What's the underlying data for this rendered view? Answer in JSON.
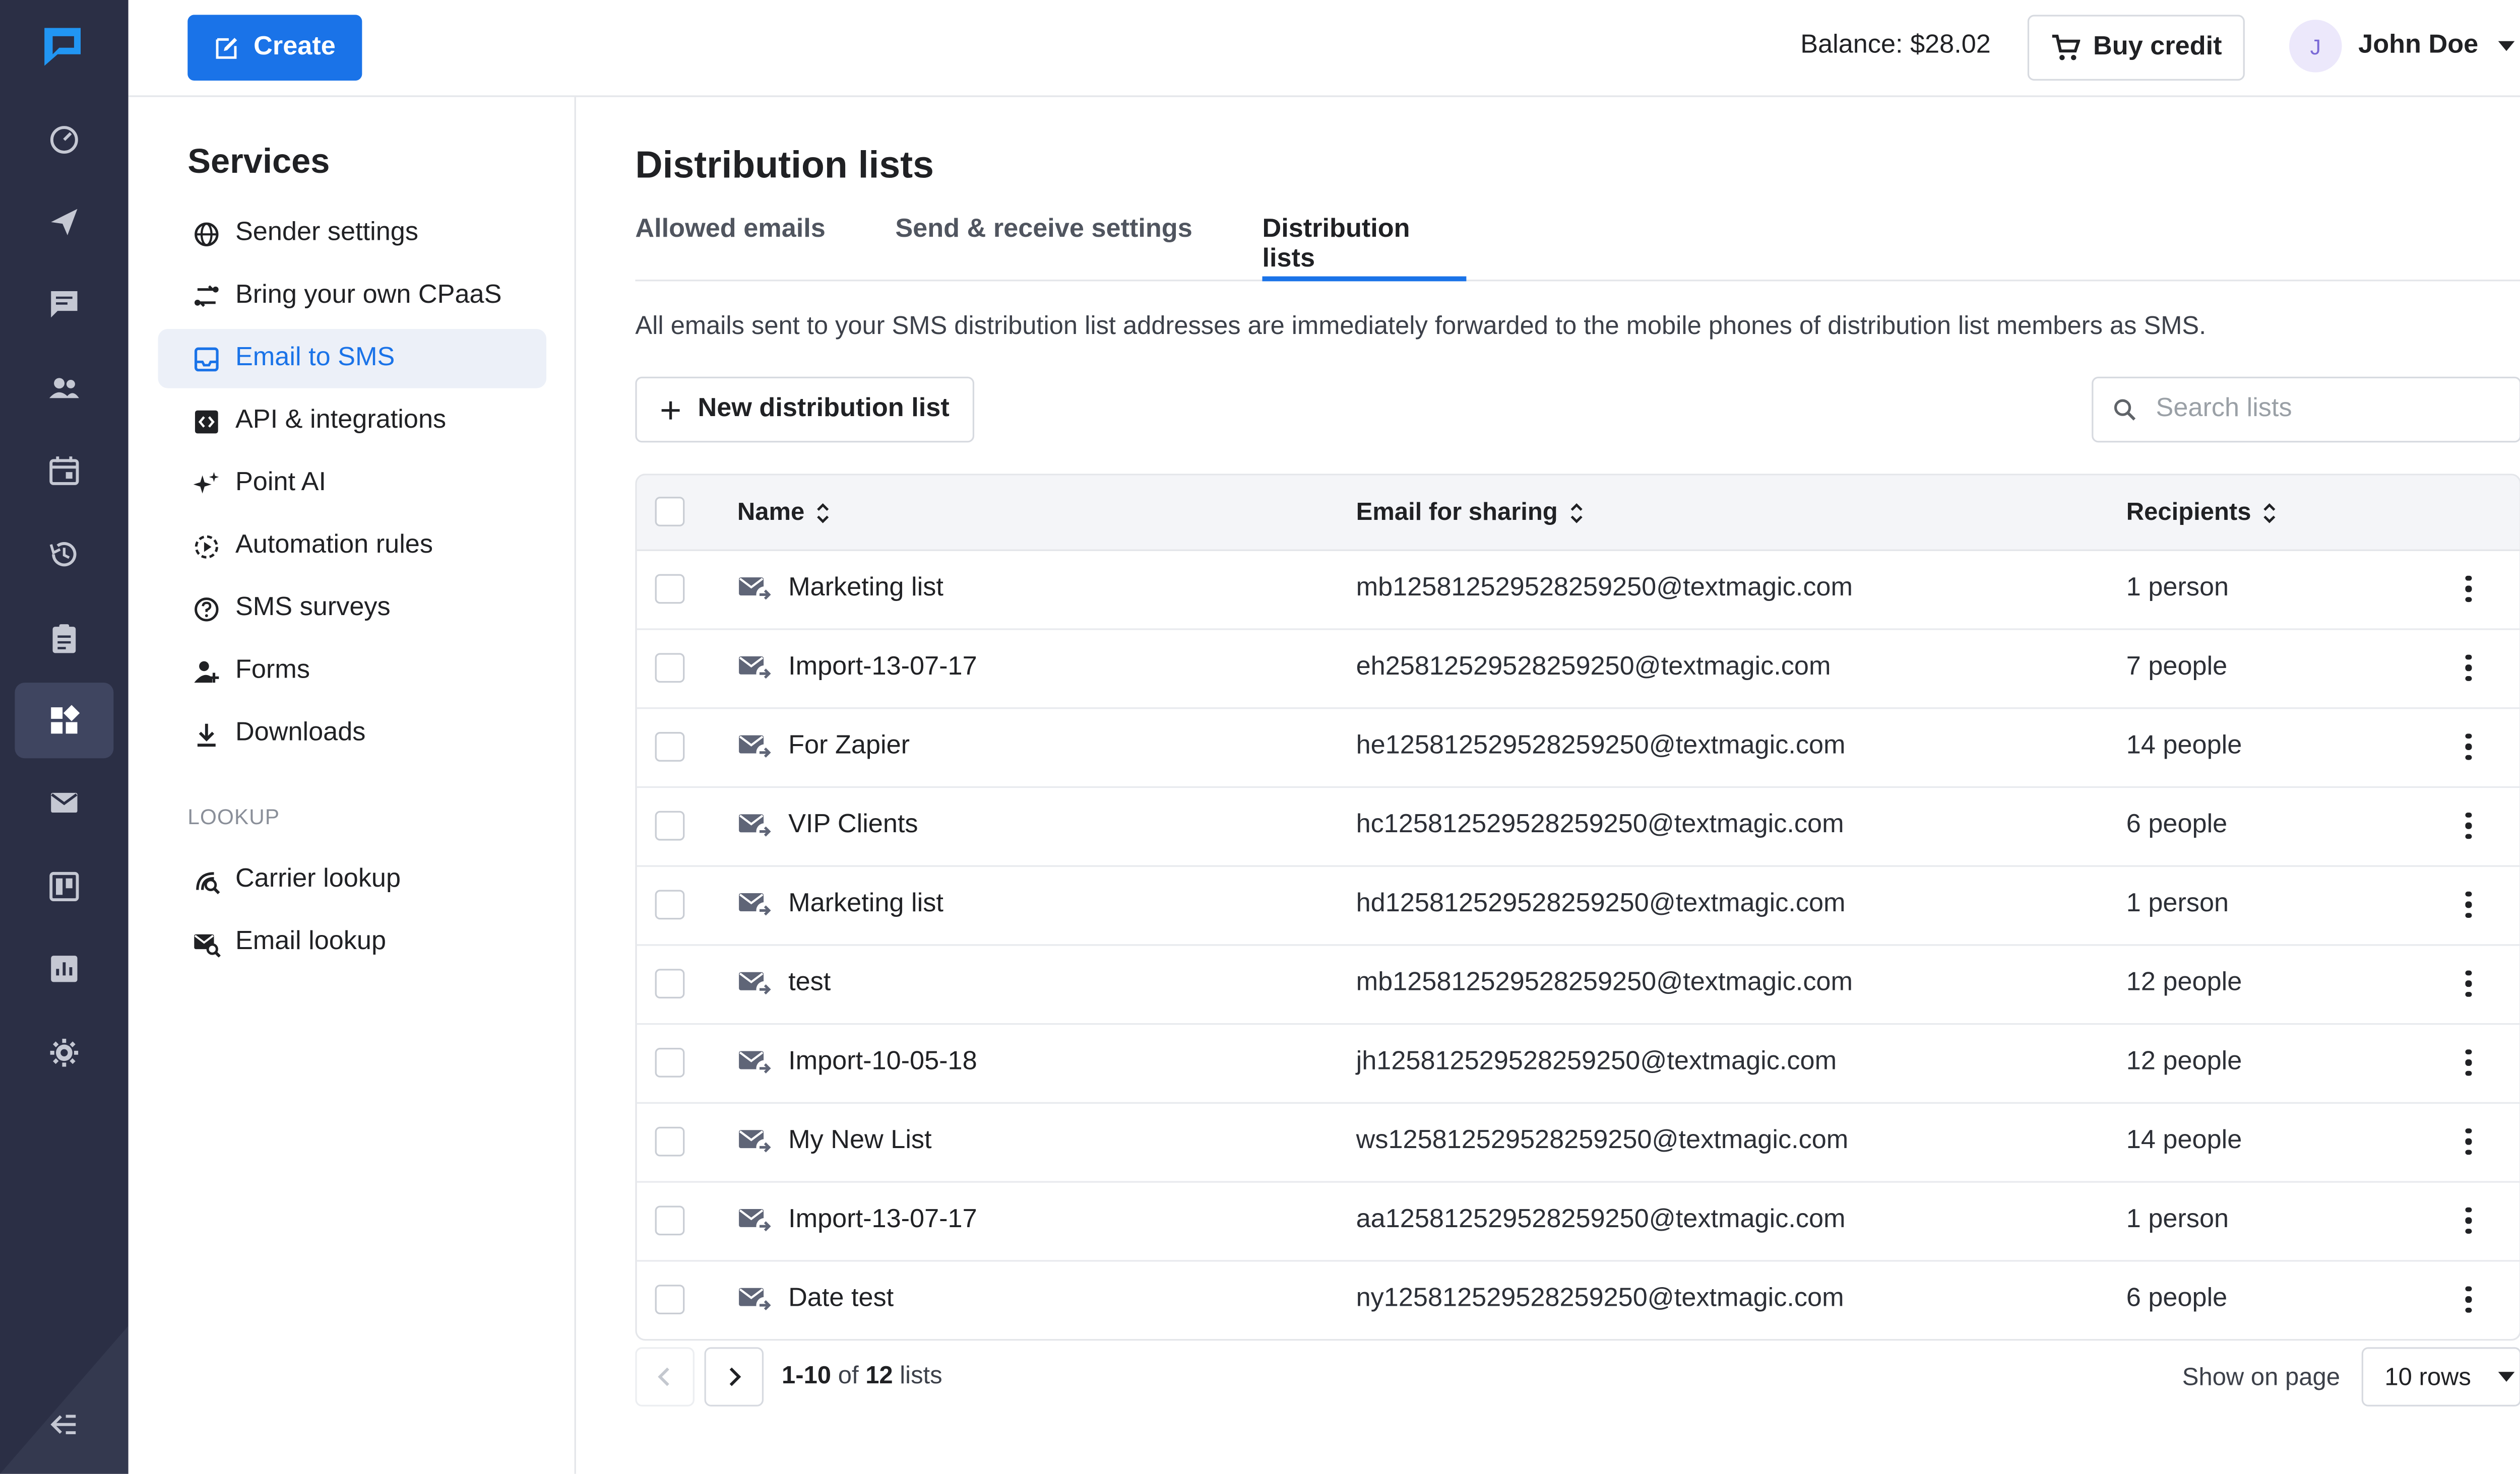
{
  "colors": {
    "accent": "#1a73e8",
    "rail_bg": "#2b2f45",
    "rail_active": "#3f4560"
  },
  "rail": {
    "logo_icon": "chat-logo-icon",
    "items": [
      {
        "icon": "speed-icon"
      },
      {
        "icon": "send-icon"
      },
      {
        "icon": "chat-icon"
      },
      {
        "icon": "contacts-icon"
      },
      {
        "icon": "calendar-icon"
      },
      {
        "icon": "history-icon"
      },
      {
        "icon": "clipboard-icon"
      },
      {
        "icon": "services-icon",
        "active": true
      },
      {
        "icon": "mail-icon"
      },
      {
        "icon": "board-icon"
      },
      {
        "icon": "reports-icon"
      },
      {
        "icon": "settings-icon"
      }
    ],
    "collapse_icon": "collapse-icon"
  },
  "topbar": {
    "create_label": "Create",
    "balance": "Balance: $28.02",
    "buy_credit_label": "Buy credit",
    "user_initial": "J",
    "user_name": "John Doe"
  },
  "services": {
    "title": "Services",
    "items": [
      {
        "label": "Sender settings",
        "icon": "globe-icon"
      },
      {
        "label": "Bring your own CPaaS",
        "icon": "connect-icon"
      },
      {
        "label": "Email to SMS",
        "icon": "inbox-icon",
        "active": true
      },
      {
        "label": "API & integrations",
        "icon": "code-icon"
      },
      {
        "label": "Point AI",
        "icon": "sparkle-icon"
      },
      {
        "label": "Automation rules",
        "icon": "automation-icon"
      },
      {
        "label": "SMS surveys",
        "icon": "survey-icon"
      },
      {
        "label": "Forms",
        "icon": "form-icon"
      },
      {
        "label": "Downloads",
        "icon": "download-icon"
      }
    ],
    "lookup_heading": "LOOKUP",
    "lookup_items": [
      {
        "label": "Carrier lookup",
        "icon": "carrier-lookup-icon"
      },
      {
        "label": "Email lookup",
        "icon": "email-lookup-icon"
      }
    ]
  },
  "main": {
    "title": "Distribution lists",
    "tabs": [
      {
        "label": "Allowed emails"
      },
      {
        "label": "Send & receive settings"
      },
      {
        "label": "Distribution lists",
        "active": true
      }
    ],
    "description": "All emails sent to your SMS distribution list addresses are immediately forwarded to the mobile phones of distribution list members as SMS.",
    "new_button_label": "New distribution list",
    "search_placeholder": "Search lists",
    "table": {
      "columns": {
        "name": "Name",
        "email": "Email for sharing",
        "recipients": "Recipients"
      },
      "rows": [
        {
          "name": "Marketing list",
          "email": "mb125812529528259250@textmagic.com",
          "recipients": "1 person"
        },
        {
          "name": "Import-13-07-17",
          "email": "eh25812529528259250@textmagic.com",
          "recipients": "7 people"
        },
        {
          "name": "For Zapier",
          "email": "he125812529528259250@textmagic.com",
          "recipients": "14 people"
        },
        {
          "name": "VIP Clients",
          "email": "hc125812529528259250@textmagic.com",
          "recipients": "6 people"
        },
        {
          "name": "Marketing list",
          "email": "hd125812529528259250@textmagic.com",
          "recipients": "1 person"
        },
        {
          "name": "test",
          "email": "mb125812529528259250@textmagic.com",
          "recipients": "12 people"
        },
        {
          "name": "Import-10-05-18",
          "email": "jh125812529528259250@textmagic.com",
          "recipients": "12 people"
        },
        {
          "name": "My New List",
          "email": "ws125812529528259250@textmagic.com",
          "recipients": "14 people"
        },
        {
          "name": "Import-13-07-17",
          "email": "aa125812529528259250@textmagic.com",
          "recipients": "1 person"
        },
        {
          "name": "Date test",
          "email": "ny125812529528259250@textmagic.com",
          "recipients": "6 people"
        }
      ]
    },
    "pager": {
      "range": "1-10",
      "of_word": "of",
      "total": "12",
      "unit": "lists",
      "show_label": "Show on page",
      "rows_value": "10 rows"
    }
  }
}
